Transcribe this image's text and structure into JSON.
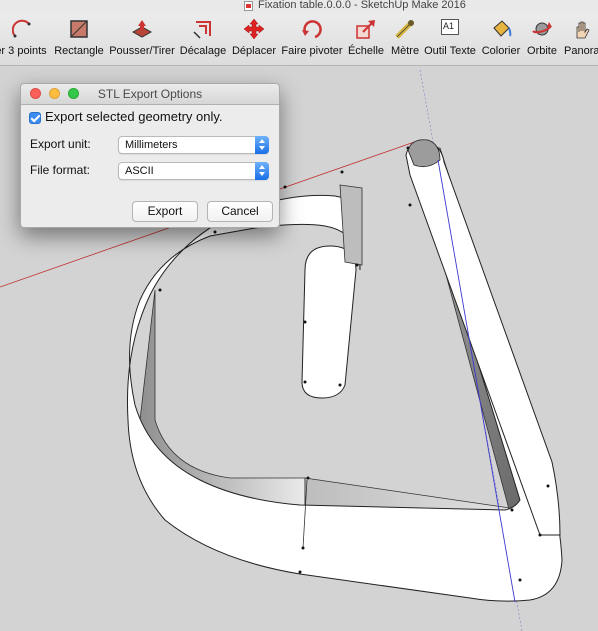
{
  "window": {
    "title": "Fixation table.0.0.0 - SketchUp Make 2016"
  },
  "toolbar": {
    "tools": [
      {
        "label": "er 3 points",
        "icon": "arc-3-points-icon"
      },
      {
        "label": "Rectangle",
        "icon": "rectangle-icon"
      },
      {
        "label": "Pousser/Tirer",
        "icon": "push-pull-icon"
      },
      {
        "label": "Décalage",
        "icon": "offset-icon"
      },
      {
        "label": "Déplacer",
        "icon": "move-icon"
      },
      {
        "label": "Faire pivoter",
        "icon": "rotate-icon"
      },
      {
        "label": "Échelle",
        "icon": "scale-icon"
      },
      {
        "label": "Mètre",
        "icon": "tape-measure-icon"
      },
      {
        "label": "Outil Texte",
        "icon": "text-tool-icon"
      },
      {
        "label": "Colorier",
        "icon": "paint-bucket-icon"
      },
      {
        "label": "Orbite",
        "icon": "orbit-icon"
      },
      {
        "label": "Panora",
        "icon": "pan-icon"
      }
    ],
    "text_tool_glyph": "A1"
  },
  "colors": {
    "accent": "#3b8df0",
    "axis_red": "#c03030",
    "axis_blue": "#3a3ad0",
    "axis_green": "#3aa83a"
  },
  "dialog": {
    "title": "STL Export Options",
    "export_selected": {
      "label": "Export selected geometry only.",
      "checked": true
    },
    "export_unit": {
      "label": "Export unit:",
      "value": "Millimeters"
    },
    "file_format": {
      "label": "File format:",
      "value": "ASCII"
    },
    "export_button": "Export",
    "cancel_button": "Cancel"
  }
}
